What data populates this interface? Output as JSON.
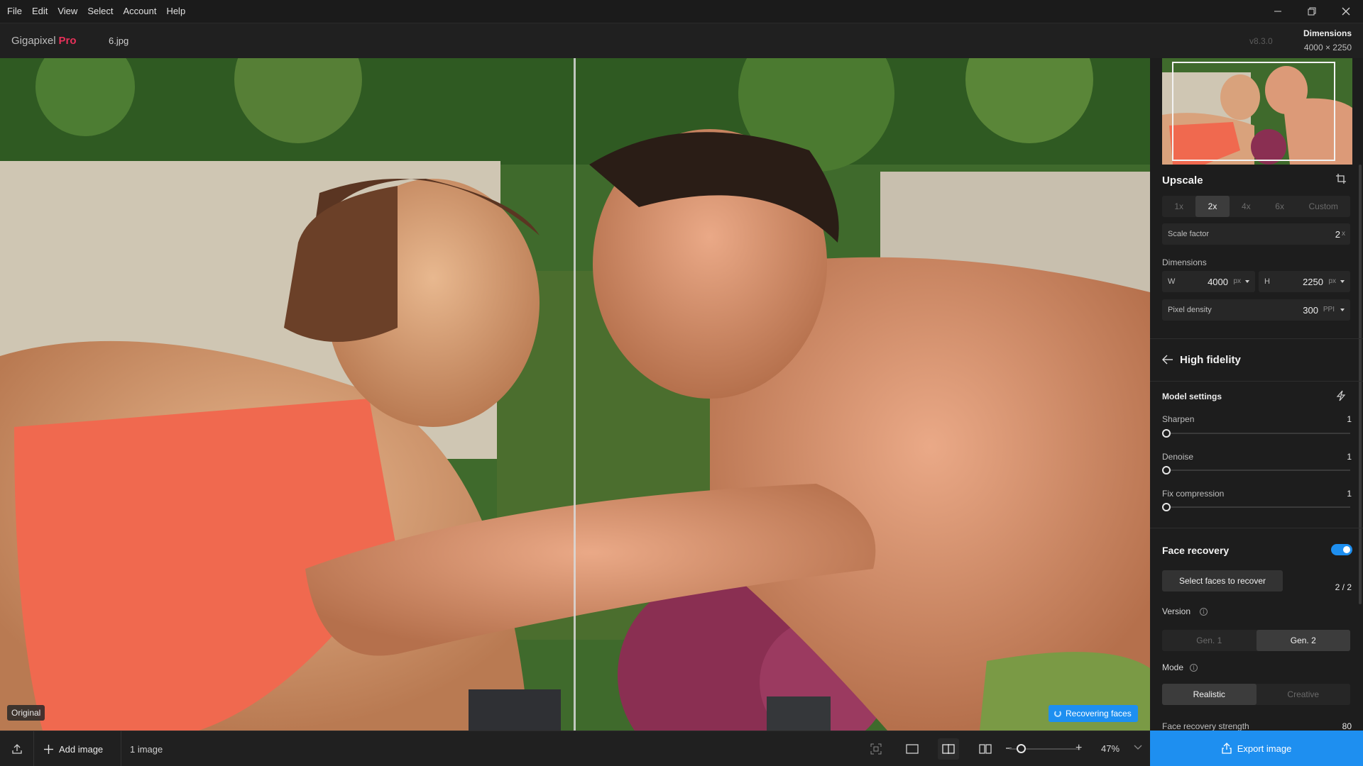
{
  "menu": [
    "File",
    "Edit",
    "View",
    "Select",
    "Account",
    "Help"
  ],
  "header": {
    "app_name": "Gigapixel",
    "app_tier": "Pro",
    "file_name": "6.jpg",
    "version": "v8.3.0",
    "dimensions_title": "Dimensions",
    "dimensions_value": "4000 × 2250"
  },
  "canvas": {
    "original_label": "Original",
    "status_badge": "Recovering faces"
  },
  "bottom": {
    "add_image": "Add image",
    "image_count": "1 image",
    "zoom": "47%",
    "zoom_fraction": 0.47
  },
  "panel": {
    "upscale": {
      "title": "Upscale",
      "options": [
        "1x",
        "2x",
        "4x",
        "6x",
        "Custom"
      ],
      "selected": "2x",
      "scale_factor_label": "Scale factor",
      "scale_factor_value": "2",
      "scale_factor_unit": "x"
    },
    "dimensions": {
      "title": "Dimensions",
      "w_label": "W",
      "w_value": "4000",
      "w_unit": "px",
      "h_label": "H",
      "h_value": "2250",
      "h_unit": "px",
      "density_label": "Pixel density",
      "density_value": "300",
      "density_unit": "PPI"
    },
    "model": {
      "name": "High fidelity",
      "settings_title": "Model settings",
      "sliders": [
        {
          "label": "Sharpen",
          "value": "1"
        },
        {
          "label": "Denoise",
          "value": "1"
        },
        {
          "label": "Fix compression",
          "value": "1"
        }
      ]
    },
    "face_recovery": {
      "title": "Face recovery",
      "enabled": true,
      "select_button": "Select faces to recover",
      "count": "2 / 2",
      "version_label": "Version",
      "versions": [
        "Gen. 1",
        "Gen. 2"
      ],
      "version_selected": "Gen. 2",
      "mode_label": "Mode",
      "modes": [
        "Realistic",
        "Creative"
      ],
      "mode_selected": "Realistic",
      "strength_label": "Face recovery strength",
      "strength_value": "80"
    },
    "export_button": "Export image"
  },
  "colors": {
    "accent": "#1e8ff0",
    "brand_pro": "#e8315a",
    "panel_bg": "#1d1d1d",
    "window_bg": "#1b1b1b"
  },
  "icons": [
    "minimize-icon",
    "restore-icon",
    "close-icon",
    "crop-icon",
    "back-arrow-icon",
    "lightning-icon",
    "info-icon",
    "upload-icon",
    "plus-icon",
    "fit-icon",
    "single-view-icon",
    "split-view-icon",
    "side-by-side-icon",
    "zoom-minus-icon",
    "zoom-plus-icon",
    "chevron-down-icon",
    "export-icon"
  ]
}
